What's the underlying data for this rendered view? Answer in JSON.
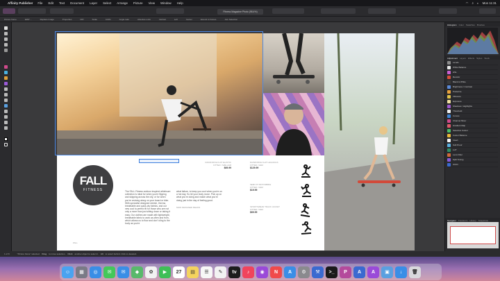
{
  "menubar": {
    "app_name": "Affinity Publisher",
    "items": [
      "File",
      "Edit",
      "Text",
      "Document",
      "Layer",
      "Select",
      "Arrange",
      "Picture",
      "View",
      "Window",
      "Help"
    ],
    "clock": "Mon 11:31"
  },
  "toolbar": {
    "doc_tab": "Fitness Magazine Photo (98.4%)"
  },
  "context_bar": {
    "items": [
      "Picture frame",
      "ERS\"...",
      "Replace Image",
      "Properties",
      "DPI",
      "Scale",
      "104%",
      "Angle ratio",
      "Absolute units",
      "Vertical",
      "Left",
      "Center",
      "Extend to frames",
      "Join Selection"
    ]
  },
  "spread": {
    "left_page": {
      "logo_main": "FALL",
      "logo_sub": "FITNESS",
      "product1": {
        "label": "RAINFORCE FLAT ELASTIC",
        "size": "FITTED / SIZE L&M",
        "price": "$69.99"
      },
      "body_col1": "The FALL Fitness outdoor inspired athleisure collection is ideal for when you're flipping and skipping across the city, or for when you're cruising along on your board or bike. With specialist designed stretch, thermo, breathable and quick-dry fabrics, and our new cool to perfect fit for those who are not only a more than just sitting down or taking it easy. Our clothes are made with lightweight, breathable fabric to work as often and from, which allows us to flow and don't cling to the body as you're",
      "body_col2": "what failure, to keep you cool when you're on a hot day. So let your body move. Pick up on what you're doing and match what you're doing just in the day of feeling good.",
      "body_col2_tail": "MAIN DESIGNED MEANS"
    },
    "right_page": {
      "product2": {
        "label": "RAINFORCE FLAT LEGGINGS",
        "size": "FITTED / S&M",
        "price": "$129.99"
      },
      "product3": {
        "label": "SEMI FIT MOTORBIKE",
        "size": "FITTED / S&M",
        "price": "$19.99"
      },
      "product4": {
        "label": "SPORTSWEAR TRACK JACKET",
        "size": "FITTED / S&M",
        "price": "$69.99"
      },
      "page_footer_left": "FALL",
      "page_footer_right": "27"
    }
  },
  "panel": {
    "tabs": [
      "Histogram",
      "Color",
      "Swatches",
      "Brushes"
    ],
    "sub_tabs": [
      "Adjustment",
      "Layers",
      "Effects",
      "Styles",
      "Stock"
    ],
    "adjustments": [
      {
        "name": "Levels",
        "color": "#8c8c8c"
      },
      {
        "name": "White Balance",
        "color": "#e8e8e8"
      },
      {
        "name": "HSL",
        "color": "#c95fd2"
      },
      {
        "name": "Recolor",
        "color": "#d84f3a"
      },
      {
        "name": "Black & White",
        "color": "#3a3a3a"
      },
      {
        "name": "Brightness / Contrast",
        "color": "#5a8ad8"
      },
      {
        "name": "Posterize",
        "color": "#e9a23b"
      },
      {
        "name": "Vibrance",
        "color": "#e2c34a"
      },
      {
        "name": "Exposure",
        "color": "#f0e0a0"
      },
      {
        "name": "Shadows / Highlights",
        "color": "#a05ad0"
      },
      {
        "name": "Threshold",
        "color": "#f0f0f0"
      },
      {
        "name": "Curves",
        "color": "#3d84d6"
      },
      {
        "name": "Channel Mixer",
        "color": "#d04a8c"
      },
      {
        "name": "Gradient Map",
        "color": "#e05a6a"
      },
      {
        "name": "Selective Colour",
        "color": "#4ac06a"
      },
      {
        "name": "Colour Balance",
        "color": "#e8b838"
      },
      {
        "name": "Invert",
        "color": "#f6f6f6"
      },
      {
        "name": "Soft Proof",
        "color": "#5ab0e0"
      },
      {
        "name": "LUT",
        "color": "#2f8f66"
      },
      {
        "name": "Lens Filter",
        "color": "#d06a3a"
      },
      {
        "name": "Split Toning",
        "color": "#8a5ad8"
      },
      {
        "name": "OCIO",
        "color": "#3a6ad0"
      }
    ],
    "nav_tabs": [
      "Navigator",
      "Transform",
      "History",
      "Snapshots"
    ]
  },
  "status": {
    "page": "1 of 8",
    "hint_prefix": "\"Picture frame\" selected.",
    "drag": "Drag",
    "drag_text": "to move selection.",
    "click": "Click",
    "click_text": "another object to select it.",
    "alt": "Alt",
    "alt_text": "to select behind. Click to deselect."
  },
  "dock": {
    "apps": [
      {
        "name": "Finder",
        "color": "#4aa3f0",
        "glyph": "☺"
      },
      {
        "name": "Launchpad",
        "color": "#7a7a86",
        "glyph": "▦"
      },
      {
        "name": "Safari",
        "color": "#3a8ee6",
        "glyph": "◎"
      },
      {
        "name": "Messages",
        "color": "#44c85a",
        "glyph": "✉"
      },
      {
        "name": "Mail",
        "color": "#3a8ee6",
        "glyph": "✉"
      },
      {
        "name": "Maps",
        "color": "#59b96b",
        "glyph": "◆"
      },
      {
        "name": "Photos",
        "color": "#f2f2f2",
        "glyph": "✿"
      },
      {
        "name": "FaceTime",
        "color": "#3fbf57",
        "glyph": "▶"
      },
      {
        "name": "Calendar",
        "color": "#ffffff",
        "glyph": "27"
      },
      {
        "name": "Notes",
        "color": "#f4d35e",
        "glyph": "▤"
      },
      {
        "name": "Reminders",
        "color": "#f7f7f7",
        "glyph": "☰"
      },
      {
        "name": "Freeform",
        "color": "#f2f2f2",
        "glyph": "✎"
      },
      {
        "name": "TV",
        "color": "#1c1c1c",
        "glyph": "tv"
      },
      {
        "name": "Music",
        "color": "#f0445c",
        "glyph": "♪"
      },
      {
        "name": "Podcasts",
        "color": "#9a4ad8",
        "glyph": "◉"
      },
      {
        "name": "News",
        "color": "#f04a4a",
        "glyph": "N"
      },
      {
        "name": "App Store",
        "color": "#3a8ee6",
        "glyph": "A"
      },
      {
        "name": "System Settings",
        "color": "#8a8a8e",
        "glyph": "⚙"
      },
      {
        "name": "Xcode",
        "color": "#3a6ad0",
        "glyph": "⚒"
      },
      {
        "name": "Terminal",
        "color": "#1a1a1a",
        "glyph": ">_"
      },
      {
        "name": "Affinity Publisher",
        "color": "#b44a9c",
        "glyph": "P"
      },
      {
        "name": "Affinity Designer",
        "color": "#3a6ad0",
        "glyph": "A"
      },
      {
        "name": "Affinity Photo",
        "color": "#9a4ad8",
        "glyph": "A"
      },
      {
        "name": "Preview",
        "color": "#5aa0e0",
        "glyph": "▣"
      },
      {
        "name": "Downloads",
        "color": "#3a8ee6",
        "glyph": "↓"
      },
      {
        "name": "Trash",
        "color": "#d8d8dc",
        "glyph": "🗑"
      }
    ]
  }
}
